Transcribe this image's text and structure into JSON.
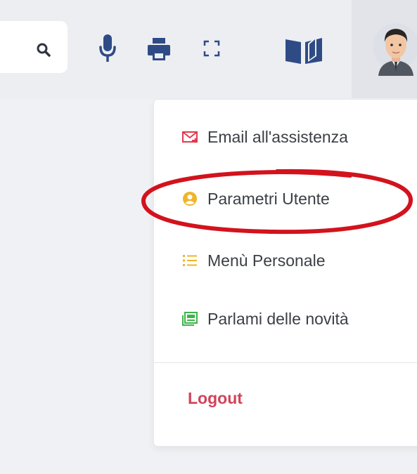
{
  "toolbar": {
    "icons": [
      "search-icon",
      "microphone-icon",
      "print-icon",
      "fullscreen-icon",
      "book-icon",
      "avatar"
    ]
  },
  "menu": {
    "items": [
      {
        "label": "Email all'assistenza",
        "icon": "email-icon",
        "icon_color": "#e03a4e"
      },
      {
        "label": "Parametri Utente",
        "icon": "user-circle-icon",
        "icon_color": "#f0b429"
      },
      {
        "label": "Menù Personale",
        "icon": "list-icon",
        "icon_color": "#f0b429"
      },
      {
        "label": "Parlami delle novità",
        "icon": "news-icon",
        "icon_color": "#3cb54a"
      }
    ],
    "logout_label": "Logout"
  },
  "colors": {
    "accent_blue": "#2f4b86",
    "logout_red": "#d2425a",
    "highlight_red": "#d2131d"
  }
}
